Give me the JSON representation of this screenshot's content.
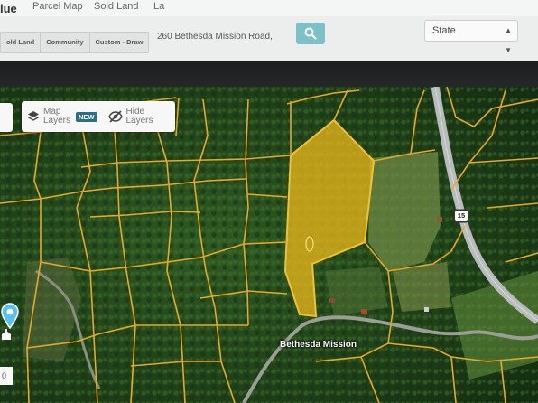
{
  "header": {
    "brand": "lue",
    "nav": [
      "Parcel Map",
      "Sold Land",
      "La"
    ]
  },
  "filters": {
    "buttons": [
      "old Land",
      "Community",
      "Custom - Draw"
    ]
  },
  "search": {
    "value": "260 Bethesda Mission Road,"
  },
  "state_select": {
    "value": "State"
  },
  "map_controls": {
    "map_layers_label": "Map Layers",
    "new_badge": "NEW",
    "hide_layers_label": "Hide Layers"
  },
  "map": {
    "route_label": "15",
    "place_label": "Bethesda Mission",
    "zoom_fragment": "0"
  },
  "colors": {
    "parcel_line": "#e9a825",
    "selected_parcel": "#e6b51a",
    "search_button": "#7cc0c8",
    "badge": "#2a6f86",
    "pin": "#58c3e8"
  }
}
